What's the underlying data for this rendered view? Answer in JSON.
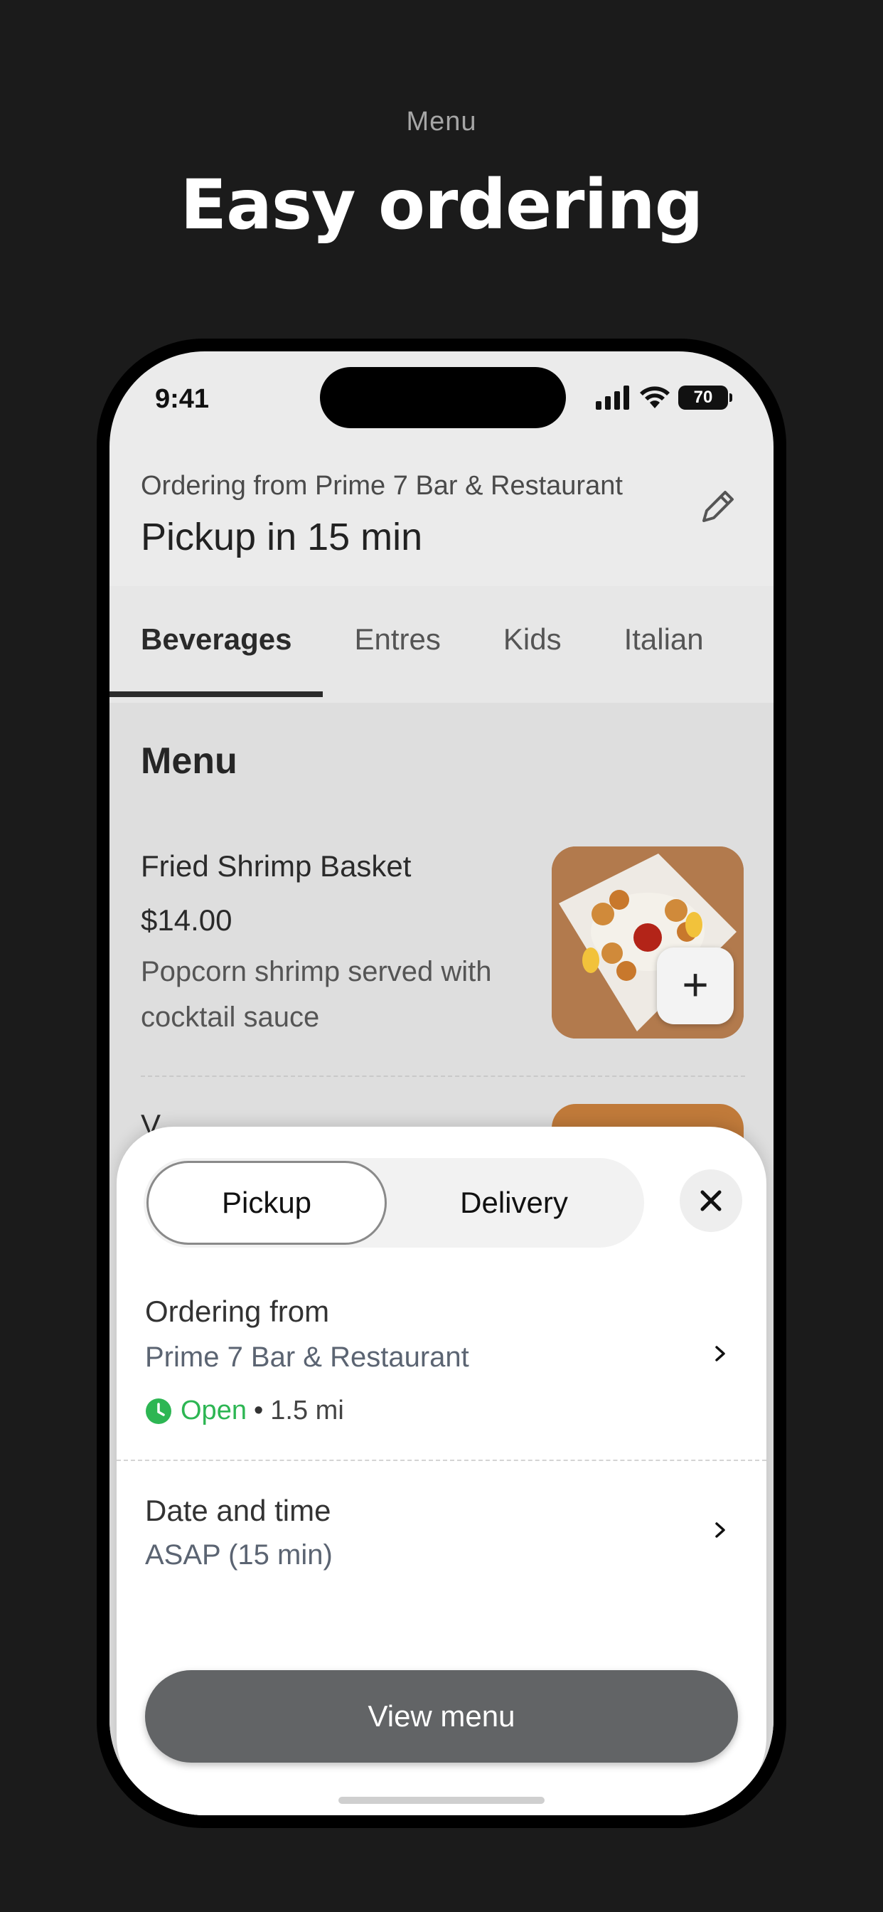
{
  "marketing": {
    "subtitle": "Menu",
    "title": "Easy ordering"
  },
  "status_bar": {
    "time": "9:41",
    "battery": "70"
  },
  "header": {
    "ordering_from": "Ordering from Prime 7 Bar & Restaurant",
    "pickup_time": "Pickup in 15 min",
    "edit_icon": "pencil-icon"
  },
  "tabs": [
    {
      "label": "Beverages",
      "active": true
    },
    {
      "label": "Entres",
      "active": false
    },
    {
      "label": "Kids",
      "active": false
    },
    {
      "label": "Italian",
      "active": false
    }
  ],
  "menu": {
    "heading": "Menu",
    "items": [
      {
        "name": "Fried Shrimp Basket",
        "price": "$14.00",
        "description": "Popcorn shrimp served with cocktail sauce",
        "add_label": "+"
      }
    ],
    "peek_item_initial": "V"
  },
  "sheet": {
    "segment": {
      "pickup": "Pickup",
      "delivery": "Delivery",
      "selected": "Pickup"
    },
    "close_icon": "close-icon",
    "ordering_from": {
      "title": "Ordering from",
      "restaurant": "Prime 7 Bar & Restaurant",
      "status": "Open",
      "distance": "1.5 mi"
    },
    "date_time": {
      "title": "Date and time",
      "value": "ASAP (15 min)"
    },
    "view_menu": "View menu"
  },
  "colors": {
    "open_green": "#2db653",
    "button_gray": "#626466",
    "background": "#1b1b1b"
  }
}
